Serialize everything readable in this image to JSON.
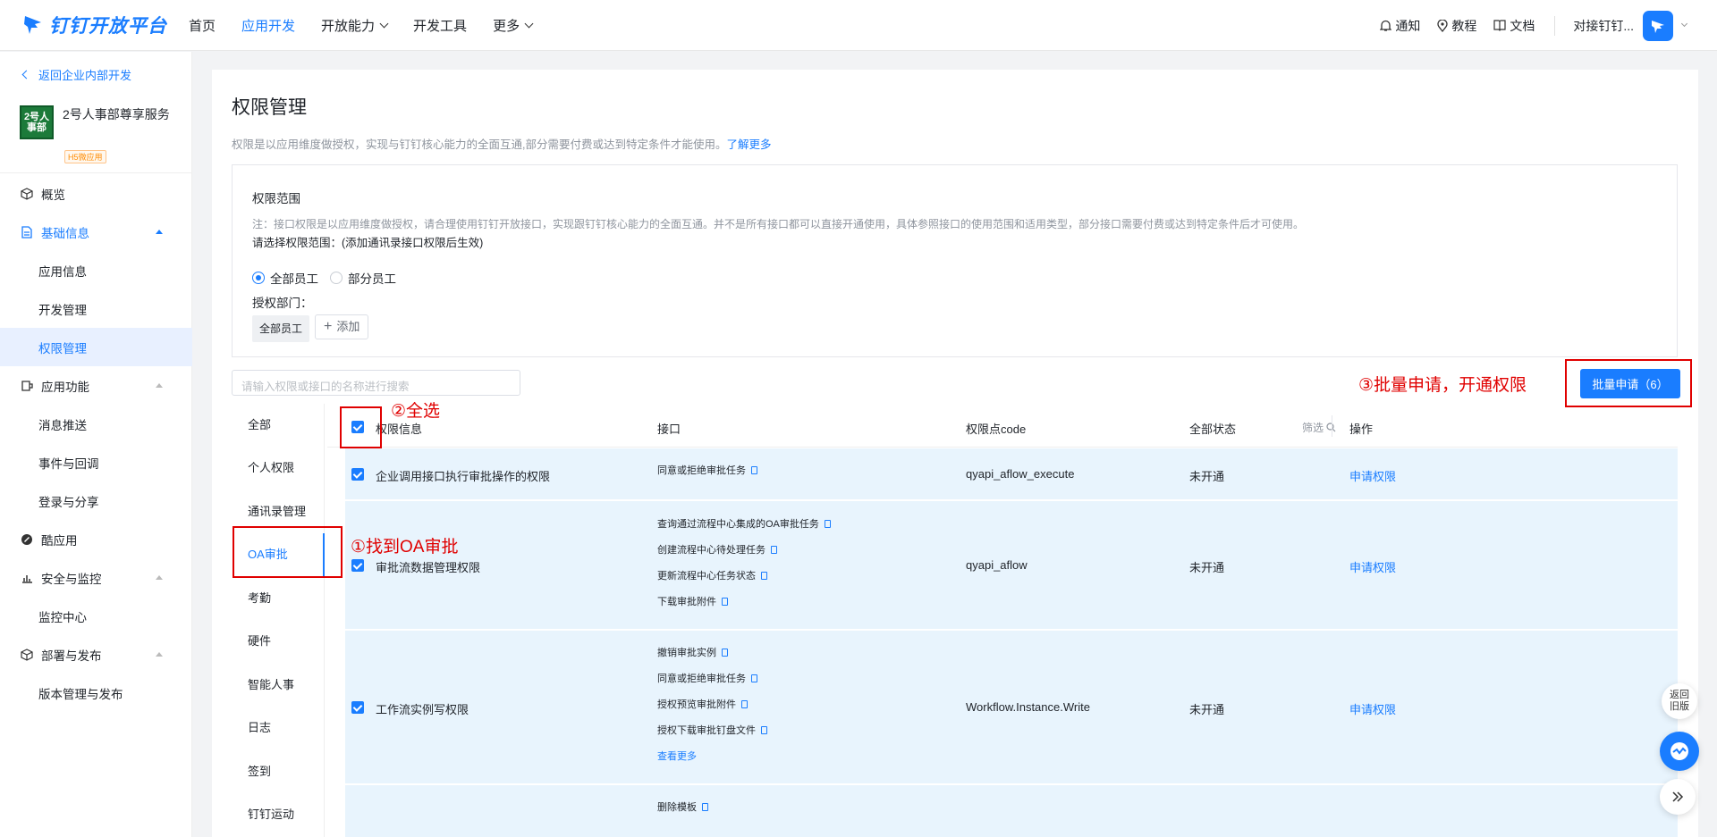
{
  "topbar": {
    "logo_text": "钉钉开放平台",
    "nav": [
      "首页",
      "应用开发",
      "开放能力",
      "开发工具",
      "更多"
    ],
    "active_nav": "应用开发",
    "notify": "通知",
    "tutorial": "教程",
    "docs": "文档",
    "org": "对接钉钉..."
  },
  "sidebar": {
    "back": "返回企业内部开发",
    "app_icon_text": "2号人事部",
    "app_name": "2号人事部尊享服务",
    "app_tag": "H5微应用",
    "menu": {
      "overview": "概览",
      "basic": "基础信息",
      "app_info": "应用信息",
      "dev_manage": "开发管理",
      "perm_manage": "权限管理",
      "app_func": "应用功能",
      "msg_push": "消息推送",
      "event_cb": "事件与回调",
      "login_share": "登录与分享",
      "ku_app": "酷应用",
      "security": "安全与监控",
      "monitor": "监控中心",
      "deploy": "部署与发布",
      "version": "版本管理与发布"
    }
  },
  "main": {
    "title": "权限管理",
    "desc": "权限是以应用维度做授权，实现与钉钉核心能力的全面互通,部分需要付费或达到特定条件才能使用。",
    "learn_more": "了解更多",
    "scope": {
      "heading": "权限范围",
      "note": "注：接口权限是以应用维度做授权，请合理使用钉钉开放接口，实现跟钉钉核心能力的全面互通。并不是所有接口都可以直接开通使用，具体参照接口的使用范围和适用类型，部分接口需要付费或达到特定条件后才可使用。",
      "hint": "请选择权限范围：(添加通讯录接口权限后生效)",
      "radio_all": "全部员工",
      "radio_part": "部分员工",
      "dept_label": "授权部门：",
      "chip": "全部员工",
      "add": "添加"
    },
    "search_placeholder": "请输入权限或接口的名称进行搜索",
    "batch_btn": "批量申请（6）",
    "categories": [
      "全部",
      "个人权限",
      "通讯录管理",
      "OA审批",
      "考勤",
      "硬件",
      "智能人事",
      "日志",
      "签到",
      "钉钉运动"
    ],
    "selected_category": "OA审批",
    "table": {
      "headers": {
        "info": "权限信息",
        "api": "接口",
        "code": "权限点code",
        "status": "全部状态",
        "filter": "筛选",
        "op": "操作"
      },
      "rows": [
        {
          "name": "企业调用接口执行审批操作的权限",
          "apis": [
            "同意或拒绝审批任务"
          ],
          "code": "qyapi_aflow_execute",
          "status": "未开通",
          "op": "申请权限"
        },
        {
          "name": "审批流数据管理权限",
          "apis": [
            "查询通过流程中心集成的OA审批任务",
            "创建流程中心待处理任务",
            "更新流程中心任务状态",
            "下载审批附件"
          ],
          "code": "qyapi_aflow",
          "status": "未开通",
          "op": "申请权限"
        },
        {
          "name": "工作流实例写权限",
          "apis": [
            "撤销审批实例",
            "同意或拒绝审批任务",
            "授权预览审批附件",
            "授权下载审批钉盘文件"
          ],
          "more": "查看更多",
          "code": "Workflow.Instance.Write",
          "status": "未开通",
          "op": "申请权限"
        },
        {
          "name": "",
          "apis": [
            "删除模板"
          ],
          "code": "",
          "status": "",
          "op": ""
        }
      ]
    }
  },
  "annotations": {
    "a1": "①找到OA审批",
    "a2": "②全选",
    "a3": "③批量申请，开通权限"
  },
  "floats": {
    "old": "返回旧版"
  },
  "colors": {
    "accent": "#1a7dff",
    "annotation": "#e00000",
    "row_bg": "#e8f4fd"
  }
}
